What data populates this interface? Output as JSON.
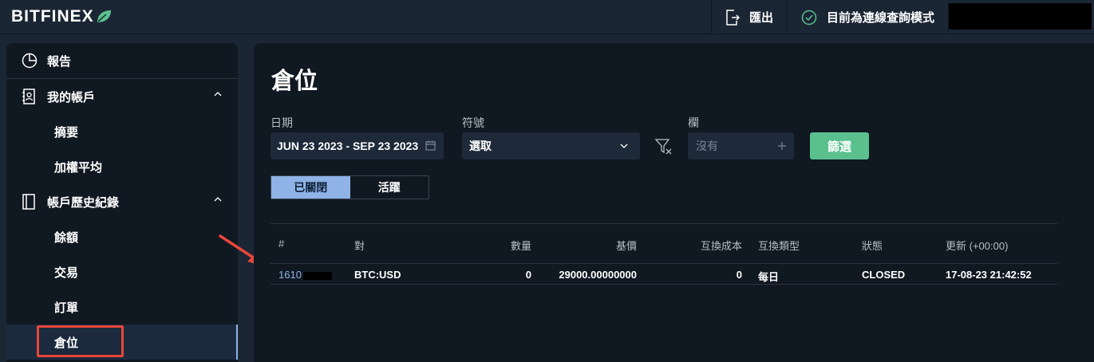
{
  "brand": {
    "name": "BITFINEX"
  },
  "topbar": {
    "export_label": "匯出",
    "status_label": "目前為連線查詢模式"
  },
  "sidebar": {
    "reports": "報告",
    "my_account": "我的帳戶",
    "summary": "摘要",
    "weighted_avg": "加權平均",
    "history": "帳戶歷史紀錄",
    "balance": "餘額",
    "trades": "交易",
    "orders": "訂單",
    "positions": "倉位"
  },
  "main": {
    "title": "倉位",
    "filters": {
      "date_label": "日期",
      "date_value": "JUN 23 2023 - SEP 23 2023",
      "symbol_label": "符號",
      "symbol_value": "選取",
      "column_label": "欄",
      "column_placeholder": "沒有",
      "filter_button": "篩選"
    },
    "tabs": {
      "closed": "已關閉",
      "active": "活躍"
    },
    "table": {
      "headers": [
        "#",
        "對",
        "數量",
        "基價",
        "互換成本",
        "互換類型",
        "狀態",
        "更新 (+00:00)"
      ],
      "rows": [
        {
          "id": "1610",
          "pair": "BTC:USD",
          "amount": "0",
          "base_price": "29000.00000000",
          "swap_cost": "0",
          "swap_type": "每日",
          "status": "CLOSED",
          "updated": "17-08-23 21:42:52"
        }
      ]
    }
  },
  "colors": {
    "accent": "#8fb3e6",
    "green": "#5ac18e",
    "annotation": "#e8463a"
  }
}
